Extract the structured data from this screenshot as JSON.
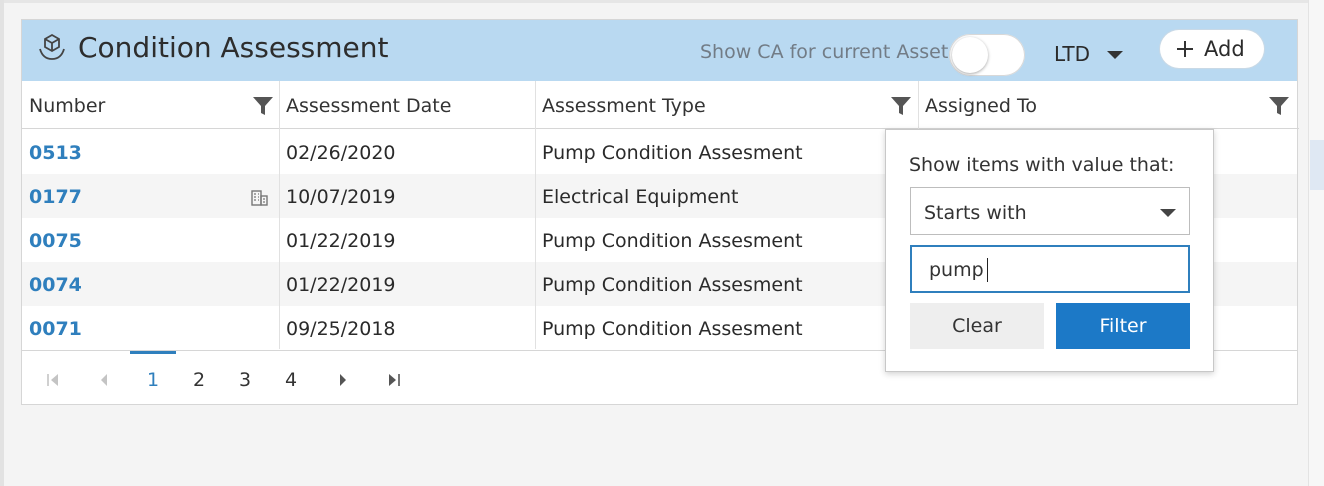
{
  "panel": {
    "title": "Condition Assessment",
    "toggle_label": "Show CA for current Asset",
    "toggle_on": false,
    "ltd_label": "LTD",
    "add_label": "Add",
    "add_icon": "plus-icon",
    "title_icon": "hands-cube-icon"
  },
  "columns": [
    {
      "label": "Number",
      "filterable": true
    },
    {
      "label": "Assessment Date",
      "filterable": false
    },
    {
      "label": "Assessment Type",
      "filterable": true
    },
    {
      "label": "Assigned To",
      "filterable": true
    }
  ],
  "rows": [
    {
      "number": "0513",
      "date": "02/26/2020",
      "type": "Pump Condition Assesment",
      "building_icon": false
    },
    {
      "number": "0177",
      "date": "10/07/2019",
      "type": "Electrical Equipment",
      "building_icon": true
    },
    {
      "number": "0075",
      "date": "01/22/2019",
      "type": "Pump Condition Assesment",
      "building_icon": false
    },
    {
      "number": "0074",
      "date": "01/22/2019",
      "type": "Pump Condition Assesment",
      "building_icon": false
    },
    {
      "number": "0071",
      "date": "09/25/2018",
      "type": "Pump Condition Assesment",
      "building_icon": false
    }
  ],
  "pager": {
    "pages": [
      "1",
      "2",
      "3",
      "4"
    ],
    "active_page": "1"
  },
  "filter_popup": {
    "title": "Show items with value that:",
    "operator": "Starts with",
    "value": "pump",
    "clear_label": "Clear",
    "filter_label": "Filter"
  },
  "colors": {
    "header_bg": "#b9d9f1",
    "link": "#2f7fbd",
    "primary_button": "#1c79c7"
  }
}
